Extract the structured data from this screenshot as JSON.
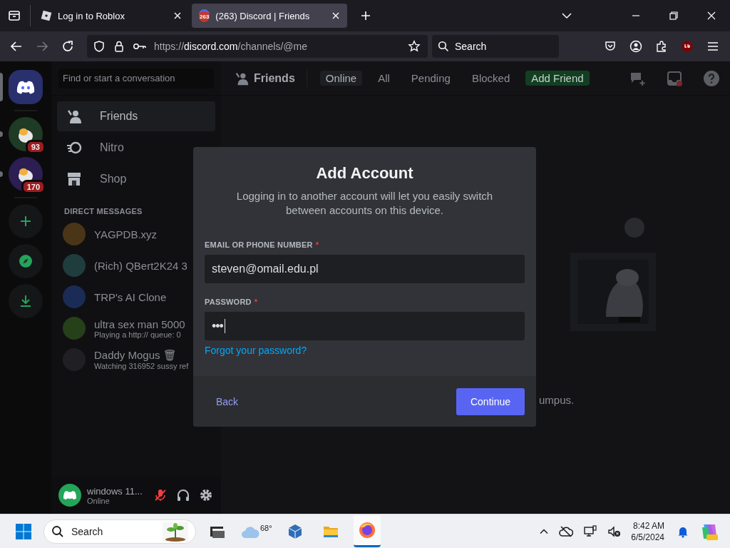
{
  "browser": {
    "tabs": [
      {
        "title": "Log in to Roblox",
        "selected": false
      },
      {
        "title": "(263) Discord | Friends",
        "selected": true,
        "badge": "263"
      }
    ],
    "url": {
      "scheme": "https://",
      "host": "discord.com",
      "path": "/channels/@me"
    },
    "search": {
      "placeholder": "Search"
    }
  },
  "servers": [
    {
      "kind": "home",
      "selected": true,
      "unread": false
    },
    {
      "kind": "server",
      "selected": false,
      "unread": true,
      "badge": "93",
      "color": "#1f3a25"
    },
    {
      "kind": "server",
      "selected": false,
      "unread": true,
      "badge": "170",
      "color": "#2c1d52"
    },
    {
      "kind": "add"
    },
    {
      "kind": "discover"
    },
    {
      "kind": "download"
    }
  ],
  "sidebar": {
    "search": {
      "placeholder": "Find or start a conversation"
    },
    "nav": [
      {
        "label": "Friends",
        "kind": "friends",
        "selected": true
      },
      {
        "label": "Nitro",
        "kind": "nitro",
        "selected": false
      },
      {
        "label": "Shop",
        "kind": "shop",
        "selected": false
      }
    ],
    "section": "DIRECT MESSAGES",
    "dms": [
      {
        "name": "YAGPDB.xyz",
        "color": "#4a3518"
      },
      {
        "name": "(Rich) QBert2K24 3",
        "color": "#1f3d3d"
      },
      {
        "name": "TRP's AI Clone",
        "color": "#1a2c55"
      },
      {
        "name": "ultra sex man 5000",
        "subtitle": "Playing a http:// queue: 0",
        "color": "#26401a"
      },
      {
        "name": "Daddy Mogus 🗑",
        "subtitle": "Watching 316952 sussy ref",
        "color": "#202024"
      }
    ],
    "user": {
      "name": "windows 11...",
      "status": "Online",
      "muted": true
    }
  },
  "header": {
    "title": "Friends",
    "tabs": [
      {
        "label": "Online",
        "kind": "filter",
        "selected": true
      },
      {
        "label": "All",
        "kind": "filter",
        "selected": false
      },
      {
        "label": "Pending",
        "kind": "filter",
        "selected": false
      },
      {
        "label": "Blocked",
        "kind": "filter",
        "selected": false
      },
      {
        "label": "Add Friend",
        "kind": "add",
        "selected": false
      }
    ]
  },
  "main": {
    "empty_text": "umpus."
  },
  "modal": {
    "title": "Add Account",
    "description": "Logging in to another account will let you easily switch between accounts on this device.",
    "fields": [
      {
        "label": "EMAIL OR PHONE NUMBER",
        "required_mark": "*",
        "kind": "text",
        "value": "steven@omail.edu.pl"
      },
      {
        "label": "PASSWORD",
        "required_mark": "*",
        "kind": "password",
        "value": "•••"
      }
    ],
    "link": "Forgot your password?",
    "back": "Back",
    "continue": "Continue"
  },
  "taskbar": {
    "search": {
      "placeholder": "Search"
    },
    "weather": "68°",
    "apps": [
      {
        "kind": "terminal",
        "active": false
      },
      {
        "kind": "cube",
        "active": false
      },
      {
        "kind": "folder",
        "active": false
      },
      {
        "kind": "firefox",
        "active": true
      }
    ],
    "time": "8:42 AM",
    "date": "6/5/2024"
  }
}
